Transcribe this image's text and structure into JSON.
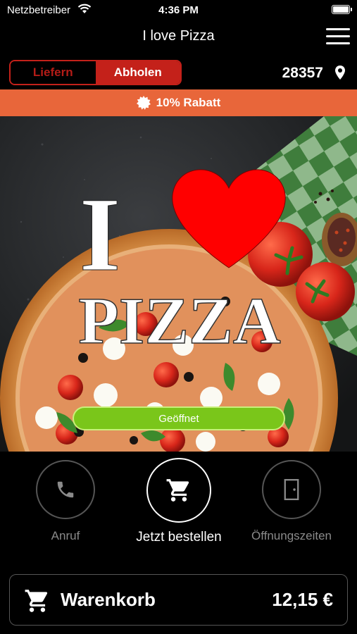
{
  "status_bar": {
    "carrier": "Netzbetreiber",
    "time": "4:36 PM"
  },
  "nav": {
    "title": "I love Pizza"
  },
  "order_mode": {
    "options": [
      "Liefern",
      "Abholen"
    ],
    "selected": "Abholen"
  },
  "location": {
    "zip": "28357"
  },
  "promo": {
    "text": "10% Rabatt"
  },
  "hero": {
    "logo_letter": "I",
    "logo_word": "PIZZA",
    "status_button": "Geöffnet"
  },
  "actions": [
    {
      "label": "Anruf",
      "icon": "phone-icon"
    },
    {
      "label": "Jetzt bestellen",
      "icon": "cart-icon"
    },
    {
      "label": "Öffnungszeiten",
      "icon": "door-icon"
    }
  ],
  "cart": {
    "label": "Warenkorb",
    "total": "12,15 €"
  },
  "colors": {
    "brand_red": "#c4211a",
    "promo_orange": "#e8663a",
    "open_green": "#7ac61a",
    "background": "#000000"
  }
}
